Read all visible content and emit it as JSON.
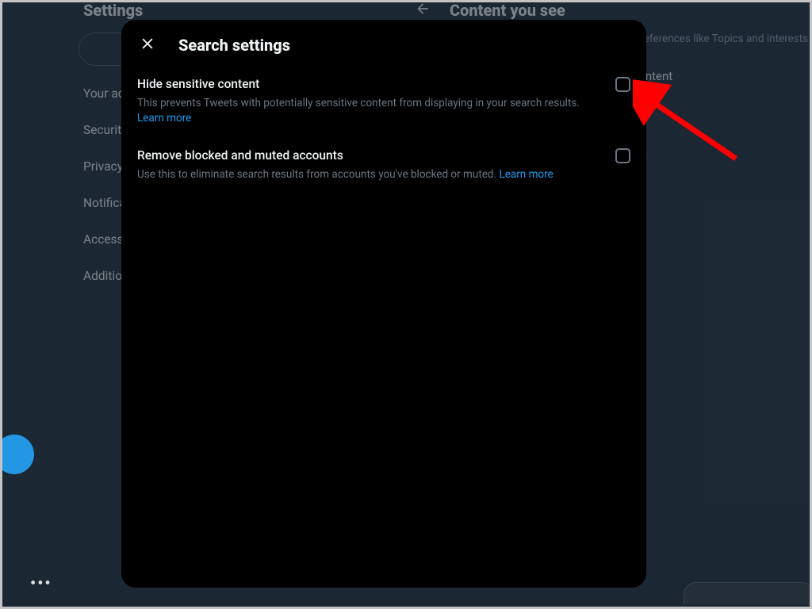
{
  "sidebar": {
    "settings_heading": "Settings",
    "items": [
      {
        "label": "Your account"
      },
      {
        "label": "Security and account access"
      },
      {
        "label": "Privacy and safety"
      },
      {
        "label": "Notifications"
      },
      {
        "label": "Accessibility, display, and languages"
      },
      {
        "label": "Additional resources"
      }
    ]
  },
  "content": {
    "heading": "Content you see",
    "sub": "Decide what you see on Twitter based on your preferences like Topics and interests",
    "row1": "Display media that may contain sensitive content"
  },
  "modal": {
    "title": "Search settings",
    "settings": [
      {
        "title": "Hide sensitive content",
        "desc": "This prevents Tweets with potentially sensitive content from displaying in your search results.",
        "learn": "Learn more"
      },
      {
        "title": "Remove blocked and muted accounts",
        "desc": "Use this to eliminate search results from accounts you've blocked or muted.",
        "learn": "Learn more"
      }
    ]
  },
  "more": "•••"
}
